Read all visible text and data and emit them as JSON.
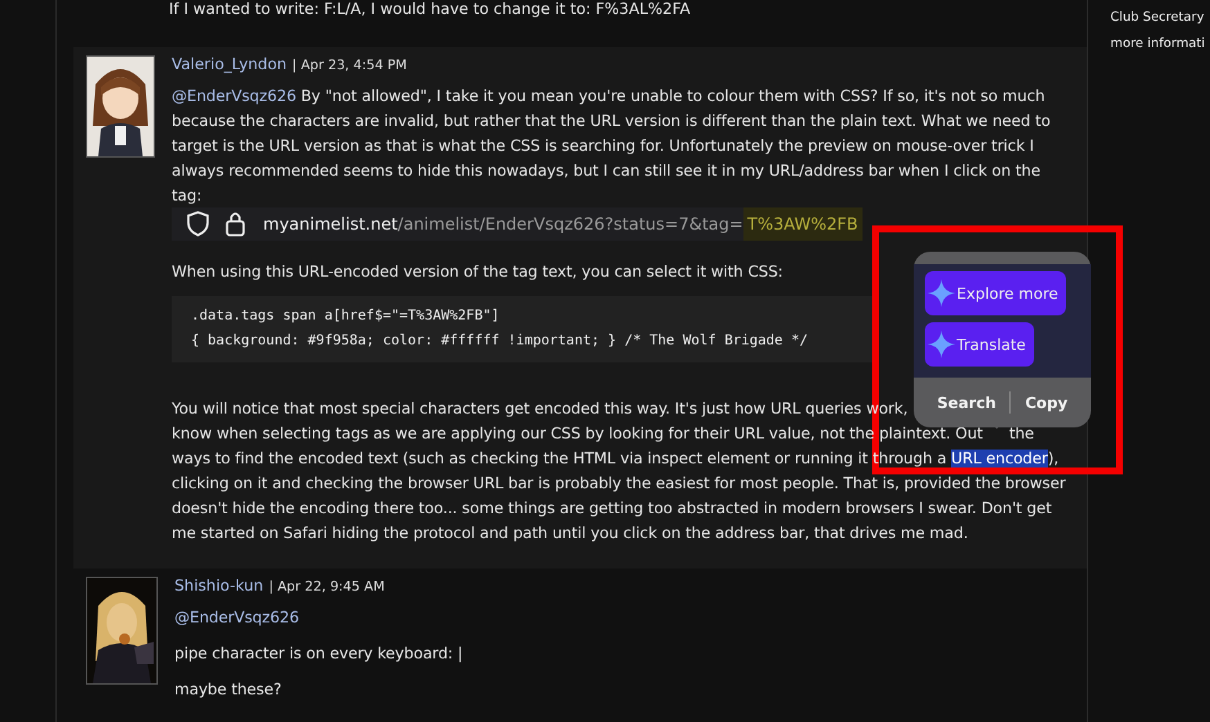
{
  "intro_line": "If I wanted to write: F:L/A, I would have to change it to: F%3AL%2FA",
  "sidebar": {
    "lines": [
      "Club Secretary",
      "more informati"
    ]
  },
  "posts": [
    {
      "author": "Valerio_Lyndon",
      "date": "| Apr 23, 4:54 PM",
      "blocks": [
        {
          "kind": "lines",
          "lines": [
            [
              {
                "kind": "mention",
                "text": "@EnderVsqz626"
              },
              {
                "kind": "text",
                "text": " By \"not allowed\", I take it you mean you're unable to colour them with CSS? If so, it's not so much"
              }
            ],
            [
              {
                "kind": "text",
                "text": "because the characters are invalid, but rather that the URL version is different than the plain text. What we need to"
              }
            ],
            [
              {
                "kind": "text",
                "text": "target is the URL version as that is what the CSS is searching for. Unfortunately the preview on mouse-over trick I"
              }
            ],
            [
              {
                "kind": "text",
                "text": "always recommended seems to hide this nowadays, but I can still see it in my URL/address bar when I click on the"
              }
            ],
            [
              {
                "kind": "text",
                "text": "tag:"
              }
            ]
          ]
        },
        {
          "kind": "address_bar",
          "host": "myanimelist.net",
          "path": "/animelist/EnderVsqz626?status=7&tag=",
          "tag": "T%3AW%2FB"
        },
        {
          "kind": "lines",
          "lines": [
            [
              {
                "kind": "text",
                "text": "When using this URL-encoded version of the tag text, you can select it with CSS:"
              }
            ]
          ]
        },
        {
          "kind": "code",
          "lines": [
            ".data.tags span a[href$=\"=T%3AW%2FB\"]",
            "{ background: #9f958a; color: #ffffff !important; } /* The Wolf Brigade */"
          ]
        },
        {
          "kind": "lines",
          "lines": [
            [
              {
                "kind": "text",
                "text": "You will notice that most special characters get encoded this way. It's just how URL queries work,"
              }
            ],
            [
              {
                "kind": "text",
                "text": "know when selecting tags as we are applying our CSS by looking for their URL value, not the plaintext. Out"
              },
              {
                "kind": "after_pointer",
                "text": "the"
              }
            ],
            [
              {
                "kind": "text",
                "text": "ways to find the encoded text (such as checking the HTML via inspect element or running it through a "
              },
              {
                "kind": "selected",
                "text": "URL encoder"
              },
              {
                "kind": "text",
                "text": "),"
              }
            ],
            [
              {
                "kind": "text",
                "text": "clicking on it and checking the browser URL bar is probably the easiest for most people. That is, provided the browser"
              }
            ],
            [
              {
                "kind": "text",
                "text": "doesn't hide the encoding there too... some things are getting too abstracted in modern browsers I swear. Don't get"
              }
            ],
            [
              {
                "kind": "text",
                "text": "me started on Safari hiding the protocol and path until you click on the address bar, that drives me mad."
              }
            ]
          ]
        }
      ]
    },
    {
      "author": "Shishio-kun",
      "date": "| Apr 22, 9:45 AM",
      "blocks": [
        {
          "kind": "lines",
          "lines": [
            [
              {
                "kind": "mention",
                "text": "@EnderVsqz626"
              }
            ]
          ]
        },
        {
          "kind": "lines",
          "lines": [
            [
              {
                "kind": "text",
                "text": "pipe character is on every keyboard: |"
              }
            ]
          ]
        },
        {
          "kind": "lines",
          "lines": [
            [
              {
                "kind": "text",
                "text": "maybe these?"
              }
            ]
          ]
        }
      ]
    }
  ],
  "selection_popup": {
    "actions": [
      {
        "label": "Explore more"
      },
      {
        "label": "Translate"
      }
    ],
    "links": [
      "Search",
      "Copy"
    ]
  }
}
